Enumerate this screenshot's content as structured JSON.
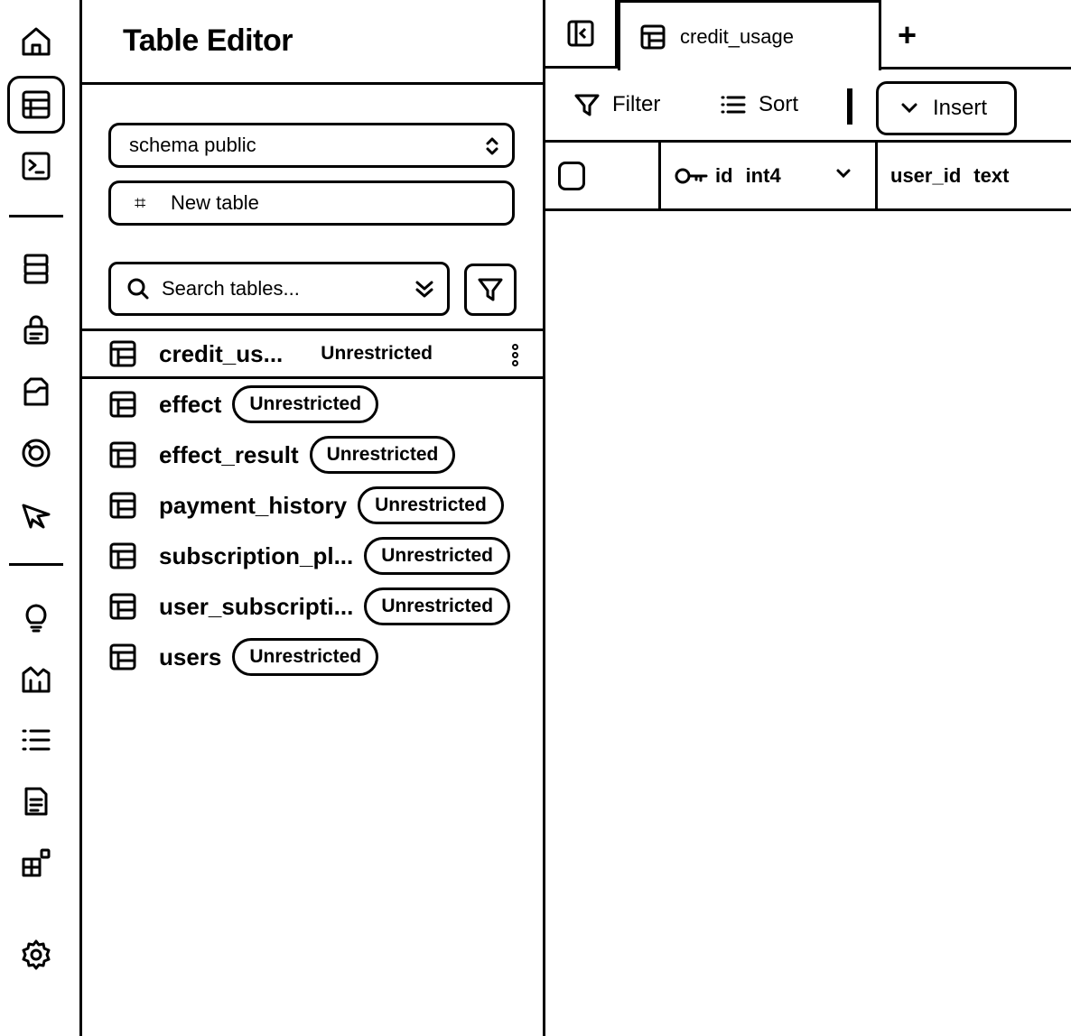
{
  "rail": {
    "icons": [
      "home-icon",
      "table-editor-icon",
      "sql-editor-icon",
      "database-icon",
      "auth-icon",
      "storage-icon",
      "realtime-icon",
      "edge-functions-icon",
      "advisors-icon",
      "reports-icon",
      "logs-icon",
      "api-docs-icon",
      "integrations-icon",
      "settings-icon"
    ],
    "active": "table-editor-icon"
  },
  "sidebar": {
    "title": "Table Editor",
    "schema_value": "schema public",
    "new_table_label": "New table",
    "search_placeholder": "Search tables...",
    "tables": [
      {
        "name": "credit_us...",
        "badge": "Unrestricted",
        "selected": true
      },
      {
        "name": "effect",
        "badge": "Unrestricted"
      },
      {
        "name": "effect_result",
        "badge": "Unrestricted"
      },
      {
        "name": "payment_history",
        "badge": "Unrestricted"
      },
      {
        "name": "subscription_pl...",
        "badge": "Unrestricted"
      },
      {
        "name": "user_subscripti...",
        "badge": "Unrestricted"
      },
      {
        "name": "users",
        "badge": "Unrestricted"
      }
    ]
  },
  "main": {
    "tab_label": "credit_usage",
    "add_tab_label": "+",
    "toolbar": {
      "filter_label": "Filter",
      "sort_label": "Sort",
      "insert_label": "Insert"
    },
    "columns": [
      {
        "name": "id",
        "type": "int4"
      },
      {
        "name": "user_id",
        "type": "text"
      }
    ]
  }
}
